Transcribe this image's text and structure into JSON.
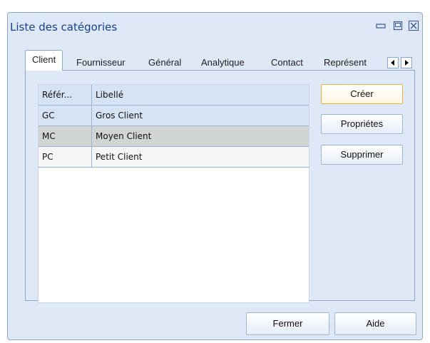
{
  "window": {
    "title": "Liste des catégories"
  },
  "tabs": [
    {
      "label": "Client",
      "active": true
    },
    {
      "label": "Fournisseur"
    },
    {
      "label": "Général"
    },
    {
      "label": "Analytique"
    },
    {
      "label": "Contact"
    },
    {
      "label": "Représent"
    }
  ],
  "grid": {
    "columns": [
      "Référ...",
      "Libellé"
    ],
    "rows": [
      {
        "ref": "GC",
        "label": "Gros Client",
        "state": "highlighted"
      },
      {
        "ref": "MC",
        "label": "Moyen Client",
        "state": "selected"
      },
      {
        "ref": "PC",
        "label": "Petit Client",
        "state": "normal"
      }
    ]
  },
  "actions": {
    "create": "Créer",
    "properties": "Propriétes",
    "delete": "Supprimer"
  },
  "footer": {
    "close": "Fermer",
    "help": "Aide"
  },
  "colors": {
    "window_bg": "#dfe8f6",
    "title_text": "#15428b",
    "border": "#8ea7cb",
    "row_highlight": "#d6e3f4",
    "row_selected": "#d0d4d2",
    "default_button_border": "#e8b33c"
  },
  "icons": {
    "minimize": "minimize-icon",
    "restore": "restore-icon",
    "close": "close-icon",
    "scroll_left": "triangle-left-icon",
    "scroll_right": "triangle-right-icon"
  }
}
